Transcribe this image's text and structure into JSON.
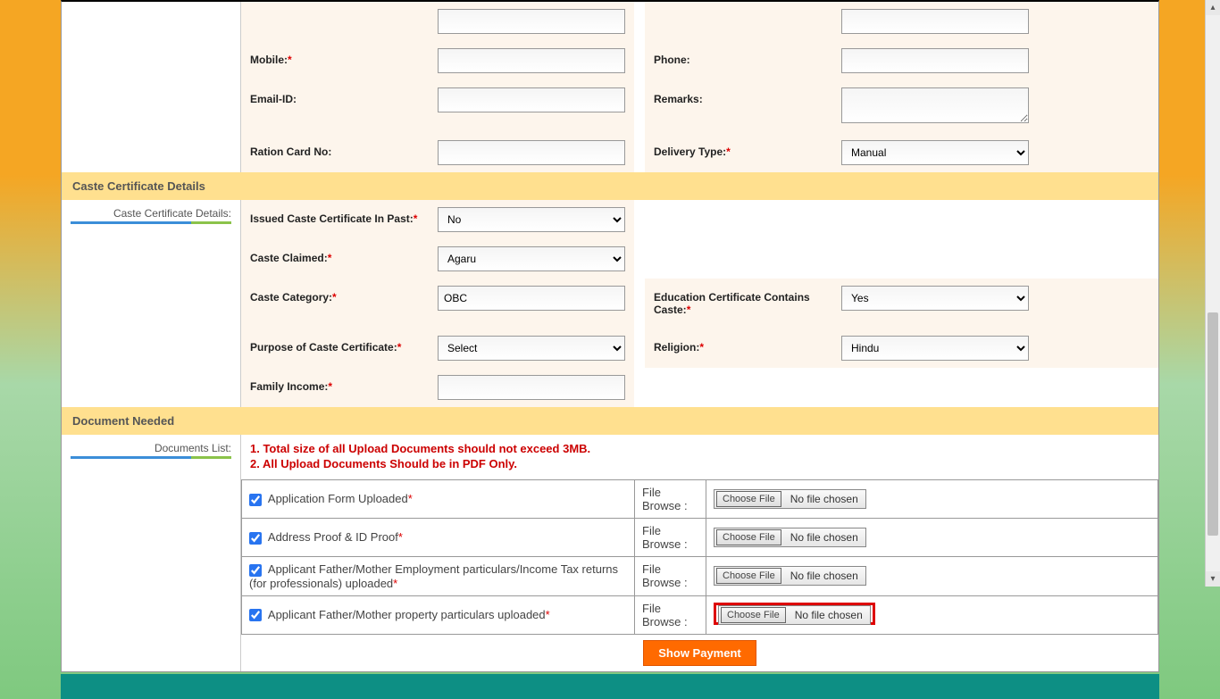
{
  "top_fields": {
    "mobile_label": "Mobile:",
    "phone_label": "Phone:",
    "email_label": "Email-ID:",
    "remarks_label": "Remarks:",
    "ration_label": "Ration Card No:",
    "delivery_label": "Delivery Type:",
    "delivery_value": "Manual"
  },
  "caste_section": {
    "header": "Caste Certificate Details",
    "side_label": "Caste Certificate Details:",
    "issued_label": "Issued Caste Certificate In Past:",
    "issued_value": "No",
    "claimed_label": "Caste Claimed:",
    "claimed_value": "Agaru",
    "category_label": "Caste Category:",
    "category_value": "OBC",
    "edu_label": "Education Certificate Contains Caste:",
    "edu_value": "Yes",
    "purpose_label": "Purpose of Caste Certificate:",
    "purpose_value": "Select",
    "religion_label": "Religion:",
    "religion_value": "Hindu",
    "family_income_label": "Family Income:"
  },
  "doc_section": {
    "header": "Document Needed",
    "side_label": "Documents List:",
    "note1": "1. Total size of all Upload Documents should not exceed 3MB.",
    "note2": "2. All Upload Documents Should be in PDF Only.",
    "browse_label": "File Browse :",
    "choose_btn": "Choose File",
    "no_file": "No file chosen",
    "row1": "Application Form Uploaded",
    "row2": "Address Proof & ID Proof",
    "row3": "Applicant Father/Mother Employment particulars/Income Tax returns (for professionals) uploaded",
    "row4": "Applicant Father/Mother property particulars uploaded"
  },
  "show_payment": "Show Payment"
}
